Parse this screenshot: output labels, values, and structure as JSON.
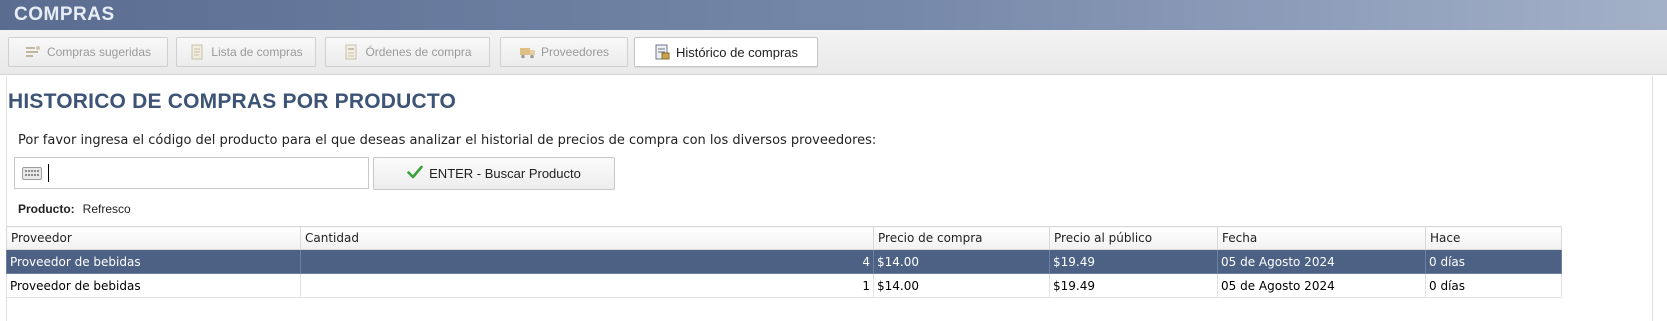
{
  "window": {
    "title": "COMPRAS"
  },
  "tabs": [
    {
      "label": "Compras sugeridas",
      "icon": "suggested-purchases-icon",
      "active": false
    },
    {
      "label": "Lista de compras",
      "icon": "shopping-list-icon",
      "active": false
    },
    {
      "label": "Órdenes de compra",
      "icon": "purchase-orders-icon",
      "active": false
    },
    {
      "label": "Proveedores",
      "icon": "suppliers-truck-icon",
      "active": false
    },
    {
      "label": "Histórico de compras",
      "icon": "purchase-history-icon",
      "active": true
    }
  ],
  "page": {
    "heading": "HISTORICO DE COMPRAS POR PRODUCTO",
    "prompt": "Por favor ingresa el código del producto para el que deseas analizar el historial de precios de compra con los diversos proveedores:"
  },
  "search": {
    "value": "",
    "button_label": "ENTER - Buscar Producto",
    "keyboard_icon": "keyboard-icon",
    "button_icon": "checkmark-icon"
  },
  "product": {
    "label": "Producto:",
    "value": "Refresco"
  },
  "table": {
    "columns": [
      "Proveedor",
      "Cantidad",
      "Precio de compra",
      "Precio al público",
      "Fecha",
      "Hace"
    ],
    "rows": [
      {
        "proveedor": "Proveedor de bebidas",
        "cantidad": "4",
        "precio_compra": "$14.00",
        "precio_publico": "$19.49",
        "fecha": "05 de Agosto 2024",
        "hace": "0 días",
        "selected": true
      },
      {
        "proveedor": "Proveedor de bebidas",
        "cantidad": "1",
        "precio_compra": "$14.00",
        "precio_publico": "$19.49",
        "fecha": "05 de Agosto 2024",
        "hace": "0 días",
        "selected": false
      }
    ]
  },
  "colors": {
    "title_bar": "#5a6d91",
    "heading": "#3d5476",
    "selected_row": "#4c6184",
    "check": "#3aa13a"
  }
}
